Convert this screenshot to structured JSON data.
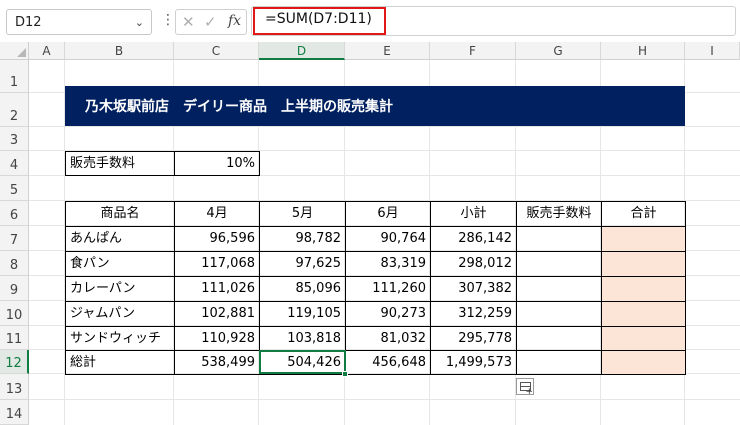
{
  "formula_bar": {
    "name_box": "D12",
    "formula": "=SUM(D7:D11)",
    "fx_label": "fx",
    "cancel_symbol": "✕",
    "enter_symbol": "✓"
  },
  "columns": [
    "A",
    "B",
    "C",
    "D",
    "E",
    "F",
    "G",
    "H",
    "I"
  ],
  "rows": [
    "1",
    "2",
    "3",
    "4",
    "5",
    "6",
    "7",
    "8",
    "9",
    "10",
    "11",
    "12",
    "13",
    "14"
  ],
  "sheet": {
    "title": "乃木坂駅前店　デイリー商品　上半期の販売集計",
    "fee_label": "販売手数料",
    "fee_value": "10%",
    "headers": [
      "商品名",
      "4月",
      "5月",
      "6月",
      "小計",
      "販売手数料",
      "合計"
    ],
    "products": [
      {
        "name": "あんぱん",
        "apr": "96,596",
        "may": "98,782",
        "jun": "90,764",
        "subtotal": "286,142",
        "fee": "",
        "total": ""
      },
      {
        "name": "食パン",
        "apr": "117,068",
        "may": "97,625",
        "jun": "83,319",
        "subtotal": "298,012",
        "fee": "",
        "total": ""
      },
      {
        "name": "カレーパン",
        "apr": "111,026",
        "may": "85,096",
        "jun": "111,260",
        "subtotal": "307,382",
        "fee": "",
        "total": ""
      },
      {
        "name": "ジャムパン",
        "apr": "102,881",
        "may": "119,105",
        "jun": "90,273",
        "subtotal": "312,259",
        "fee": "",
        "total": ""
      },
      {
        "name": "サンドウィッチ",
        "apr": "110,928",
        "may": "103,818",
        "jun": "81,032",
        "subtotal": "295,778",
        "fee": "",
        "total": ""
      }
    ],
    "total_row": {
      "name": "総計",
      "apr": "538,499",
      "may": "504,426",
      "jun": "456,648",
      "subtotal": "1,499,573",
      "fee": "",
      "total": ""
    }
  },
  "colors": {
    "title_bg": "#002060",
    "total_col_fill": "#fce4d6",
    "selection": "#107c41",
    "formula_highlight": "#e01818"
  }
}
